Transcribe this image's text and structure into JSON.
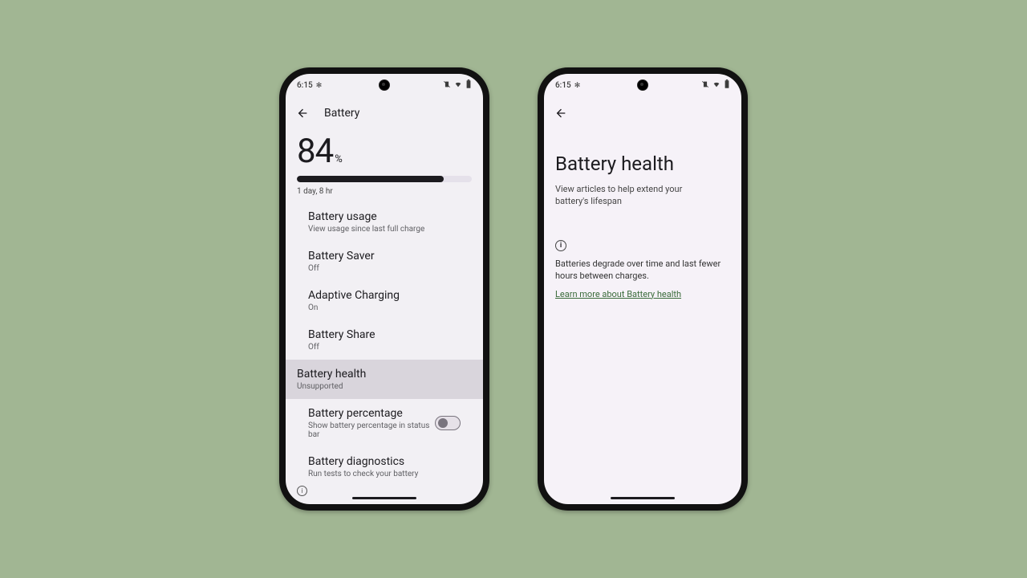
{
  "status": {
    "time": "6:15",
    "icons": {
      "gear": "gear",
      "vibrate": "vibrate",
      "wifi": "wifi",
      "battery": "battery"
    }
  },
  "left": {
    "appbar_title": "Battery",
    "percent_value": "84",
    "percent_sign": "%",
    "progress_percent": 84,
    "estimate": "1 day, 8 hr",
    "rows": {
      "usage": {
        "title": "Battery usage",
        "sub": "View usage since last full charge"
      },
      "saver": {
        "title": "Battery Saver",
        "sub": "Off"
      },
      "adaptive": {
        "title": "Adaptive Charging",
        "sub": "On"
      },
      "share": {
        "title": "Battery Share",
        "sub": "Off"
      },
      "health": {
        "title": "Battery health",
        "sub": "Unsupported"
      },
      "percentage": {
        "title": "Battery percentage",
        "sub": "Show battery percentage in status bar",
        "toggle": false
      },
      "diagnostics": {
        "title": "Battery diagnostics",
        "sub": "Run tests to check your battery"
      }
    }
  },
  "right": {
    "title": "Battery health",
    "subtitle": "View articles to help extend your battery's lifespan",
    "info_icon_label": "i",
    "body": "Batteries degrade over time and last fewer hours between charges.",
    "link": "Learn more about Battery health"
  }
}
